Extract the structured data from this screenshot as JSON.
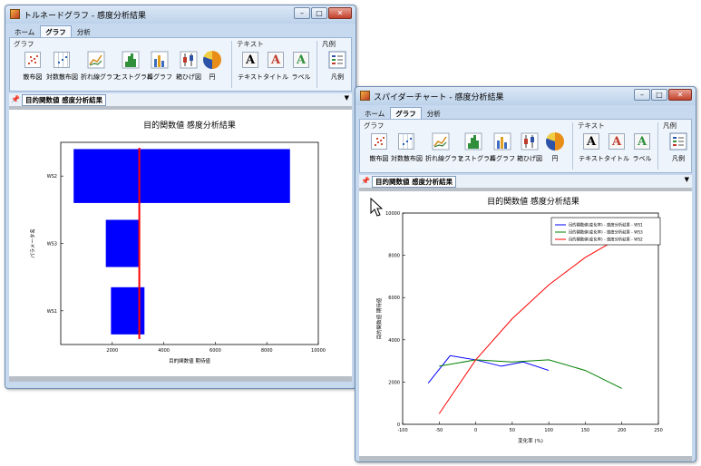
{
  "tornado_window": {
    "title": "トルネードグラフ - 感度分析結果",
    "tabs": [
      "ホーム",
      "グラフ",
      "分析"
    ],
    "active_tab": "グラフ",
    "groups": {
      "graph": "グラフ",
      "text": "テキスト",
      "legend": "凡例"
    },
    "buttons": {
      "scatter": "散布図",
      "log_scatter": "対数散布図",
      "line": "折れ線グラフ",
      "histogram": "ヒストグラム",
      "bar": "棒グラフ",
      "box": "箱ひげ図",
      "pie": "円",
      "text": "テキスト",
      "title": "タイトル",
      "label": "ラベル",
      "legend": "凡例"
    },
    "doc_tab": "目的関数値 感度分析結果",
    "window_buttons": {
      "minimize": "–",
      "maximize": "□",
      "close": "✕"
    }
  },
  "spider_window": {
    "title": "スパイダーチャート - 感度分析結果",
    "tabs": [
      "ホーム",
      "グラフ",
      "分析"
    ],
    "active_tab": "グラフ",
    "groups": {
      "graph": "グラフ",
      "text": "テキスト",
      "legend": "凡例"
    },
    "buttons": {
      "scatter": "散布図",
      "log_scatter": "対数散布図",
      "line": "折れ線グラフ",
      "histogram": "ヒストグラム",
      "bar": "棒グラフ",
      "box": "箱ひげ図",
      "pie": "円",
      "text": "テキスト",
      "title": "タイトル",
      "label": "ラベル",
      "legend": "凡例"
    },
    "doc_tab": "目的関数値 感度分析結果",
    "window_buttons": {
      "minimize": "–",
      "maximize": "□",
      "close": "✕"
    }
  },
  "chart_data": [
    {
      "type": "bar",
      "orientation": "horizontal",
      "title": "目的関数値 感度分析結果",
      "xlabel": "目的関数値 期待値",
      "ylabel": "パラメータ名",
      "xlim": [
        0,
        10000
      ],
      "xticks": [
        "2000",
        "4000",
        "6000",
        "8000",
        "10000"
      ],
      "categories": [
        "WS2",
        "WS3",
        "WS1"
      ],
      "ranges": [
        [
          500,
          8900
        ],
        [
          1750,
          3050
        ],
        [
          1950,
          3250
        ]
      ],
      "baseline": 3050,
      "colors": {
        "bar": "#0000ff",
        "baseline": "#ff0000"
      }
    },
    {
      "type": "line",
      "title": "目的関数値 感度分析結果",
      "xlabel": "変化率 (%)",
      "ylabel": "目的関数値 期待値",
      "xlim": [
        -100,
        250
      ],
      "ylim": [
        0,
        10000
      ],
      "xticks": [
        "-100",
        "-50",
        "0",
        "50",
        "100",
        "150",
        "200",
        "250"
      ],
      "yticks": [
        "0",
        "2000",
        "4000",
        "6000",
        "8000",
        "10000"
      ],
      "series": [
        {
          "name": "目的関数値(変化率) - 感度分析結果 - WS1",
          "color": "#0000ff",
          "x": [
            -65,
            -35,
            0,
            35,
            65,
            100
          ],
          "y": [
            1950,
            3250,
            3050,
            2750,
            2950,
            2550
          ]
        },
        {
          "name": "目的関数値(変化率) - 感度分析結果 - WS3",
          "color": "#008000",
          "x": [
            -50,
            0,
            50,
            100,
            150,
            200
          ],
          "y": [
            2750,
            3050,
            2950,
            3050,
            2550,
            1700
          ]
        },
        {
          "name": "目的関数値(変化率) - 感度分析結果 - WS2",
          "color": "#ff0000",
          "x": [
            -50,
            0,
            50,
            100,
            150,
            200
          ],
          "y": [
            500,
            3050,
            5000,
            6600,
            7900,
            8900
          ]
        }
      ]
    }
  ]
}
